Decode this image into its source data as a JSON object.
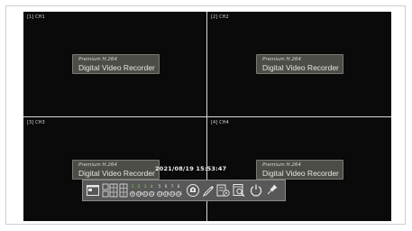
{
  "channels": [
    {
      "label": "[1] CH1",
      "title_line1": "Premium H.264",
      "title_line2": "Digital Video Recorder"
    },
    {
      "label": "[2] CH2",
      "title_line1": "Premium H.264",
      "title_line2": "Digital Video Recorder"
    },
    {
      "label": "[3] CH3",
      "title_line1": "Premium H.264",
      "title_line2": "Digital Video Recorder"
    },
    {
      "label": "[4] CH4",
      "title_line1": "Premium H.264",
      "title_line2": "Digital Video Recorder"
    }
  ],
  "timestamp": "2021/08/19 15:53:47",
  "toolbar": {
    "channel_numbers_top": [
      "1",
      "2",
      "3",
      "4",
      "5",
      "6",
      "7",
      "8"
    ],
    "channel_numbers_bottom": [
      "9",
      "10",
      "11",
      "12",
      "13",
      "14",
      "15",
      "16"
    ],
    "icons": [
      "menu-icon",
      "split-screen-icon",
      "channel-select-icon",
      "camera-icon",
      "sequence-icon",
      "pen-icon",
      "playback-icon",
      "search-icon",
      "power-icon",
      "pin-icon"
    ]
  }
}
